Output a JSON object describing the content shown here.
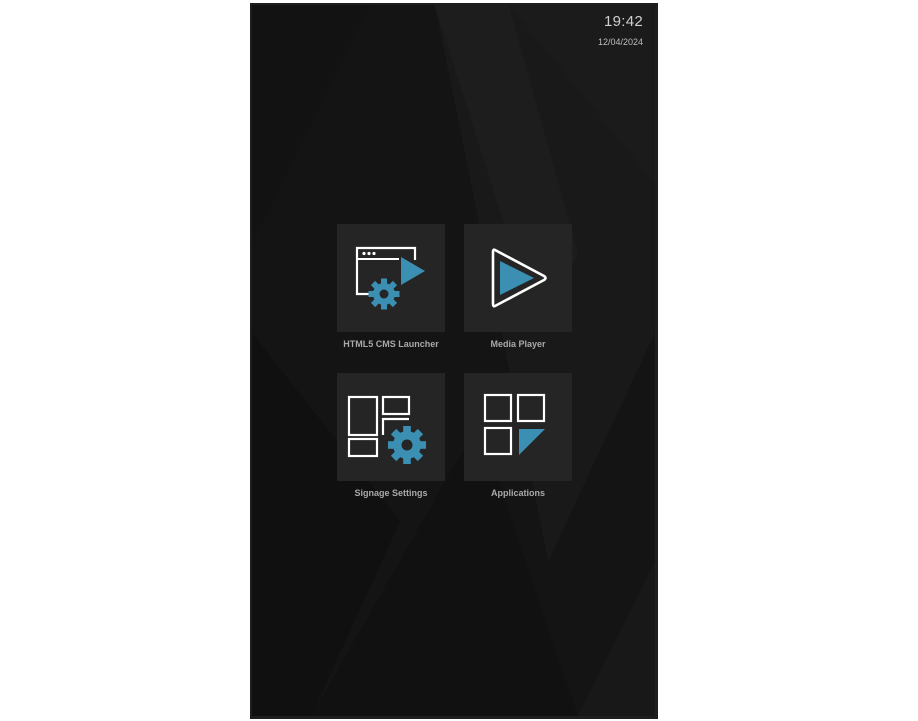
{
  "status": {
    "time": "19:42",
    "date": "12/04/2024"
  },
  "apps": [
    {
      "label": "HTML5 CMS Launcher",
      "icon": "html5-cms-launcher-icon"
    },
    {
      "label": "Media Player",
      "icon": "media-player-icon"
    },
    {
      "label": "Signage Settings",
      "icon": "signage-settings-icon"
    },
    {
      "label": "Applications",
      "icon": "applications-icon"
    }
  ],
  "colors": {
    "accent": "#3b8fb3",
    "screen_background": "#151515",
    "tile_background": "#252525",
    "label_text": "#a9a9a9"
  }
}
